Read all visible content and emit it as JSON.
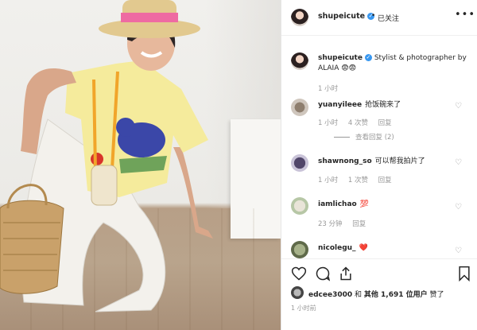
{
  "post": {
    "username": "shupeicute",
    "separator": "•",
    "follow_status": "已关注",
    "caption": "Stylist & photographer by ALAIA 😨😨",
    "caption_time": "1 小时",
    "footer_time": "1 小时前"
  },
  "comments": [
    {
      "user": "yuanyileee",
      "text": "抢饭碗来了",
      "time": "1 小时",
      "likes": "4 次赞",
      "reply": "回复",
      "view_replies": "查看回复 (2)"
    },
    {
      "user": "shawnong_so",
      "text": "可以帮我拍片了",
      "time": "1 小时",
      "likes": "1 次赞",
      "reply": "回复"
    },
    {
      "user": "iamlichao",
      "text": "💯",
      "time": "23 分钟",
      "reply": "回复"
    },
    {
      "user": "nicolegu_",
      "text": "❤️"
    }
  ],
  "likes": {
    "user": "edcee3000",
    "and": "和",
    "others": "其他 1,691 位用户",
    "suffix": "赞了"
  },
  "icons": {
    "verified": "✓",
    "more": "•••",
    "heart": "♡"
  },
  "colors": {
    "verified": "#3897f0",
    "hat_band": "#ee6aa2",
    "shirt": "#f5eb9c",
    "meta_gray": "#999999"
  }
}
